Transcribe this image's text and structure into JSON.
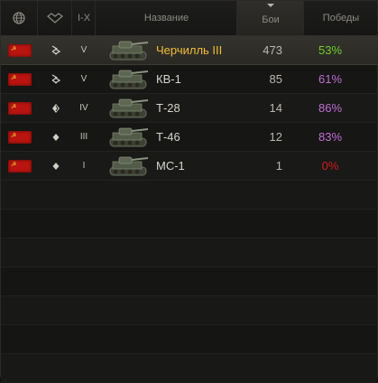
{
  "header": {
    "tier_label": "I-X",
    "name_label": "Название",
    "battles_label": "Бои",
    "wins_label": "Победы"
  },
  "icons": {
    "nation_filter": "globe-icon",
    "class_filter": "tank-class-icon",
    "sort_indicator": "chevron-down-icon",
    "flag": "ussr-flag-icon"
  },
  "colors": {
    "selected_name": "#f1be3a",
    "wins_green": "#6fd02c",
    "wins_purple": "#c36ed6",
    "wins_red": "#d21d1d"
  },
  "tanks": [
    {
      "tier": "V",
      "name": "Черчилль III",
      "battles": "473",
      "wins": "53%",
      "wins_color": "#6fd02c",
      "class": "heavy",
      "selected": true
    },
    {
      "tier": "V",
      "name": "КВ-1",
      "battles": "85",
      "wins": "61%",
      "wins_color": "#c36ed6",
      "class": "heavy",
      "selected": false
    },
    {
      "tier": "IV",
      "name": "Т-28",
      "battles": "14",
      "wins": "86%",
      "wins_color": "#c36ed6",
      "class": "medium",
      "selected": false
    },
    {
      "tier": "III",
      "name": "Т-46",
      "battles": "12",
      "wins": "83%",
      "wins_color": "#c36ed6",
      "class": "light",
      "selected": false
    },
    {
      "tier": "I",
      "name": "МС-1",
      "battles": "1",
      "wins": "0%",
      "wins_color": "#d21d1d",
      "class": "light",
      "selected": false
    }
  ]
}
